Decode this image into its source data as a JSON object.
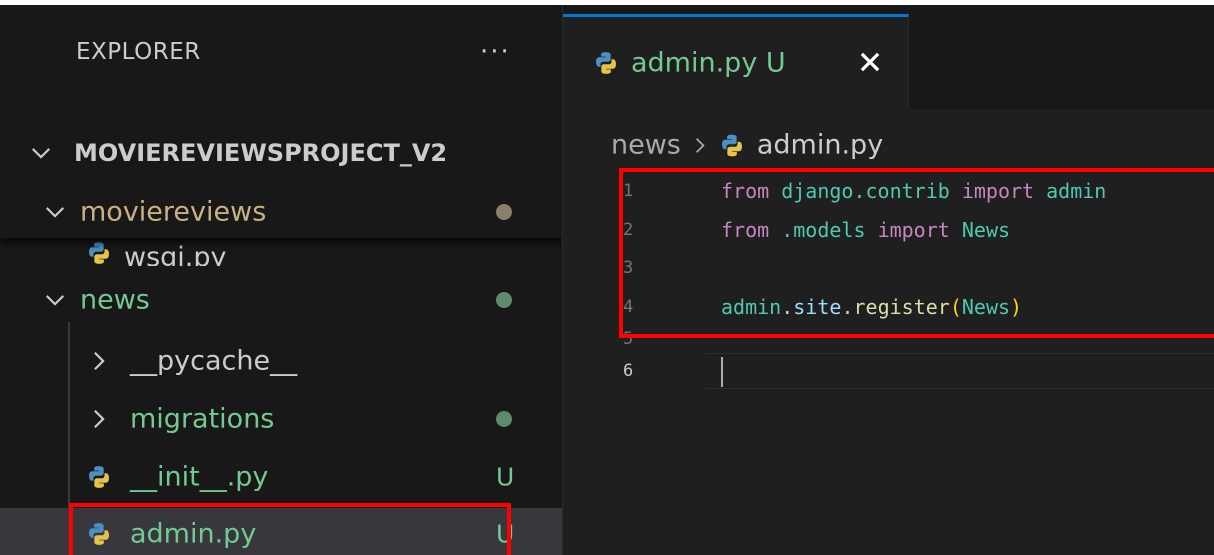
{
  "colors": {
    "sidebar_bg": "#181818",
    "editor_bg": "#1f1f1f",
    "git_untracked": "#73c991",
    "git_modified_dot": "#8b7e6a",
    "highlight": "#ff0000",
    "active_tab_border": "#0078d4"
  },
  "sidebar": {
    "title": "EXPLORER",
    "more_label": "···",
    "project": "MOVIEREVIEWSPROJECT_V2",
    "tree": [
      {
        "label": "moviereviews",
        "type": "folder",
        "expanded": true,
        "decoration": "dot"
      },
      {
        "label": "wsgi.py",
        "type": "file"
      },
      {
        "label": "news",
        "type": "folder",
        "expanded": true,
        "decoration": "dot"
      },
      {
        "label": "__pycache__",
        "type": "folder",
        "expanded": false
      },
      {
        "label": "migrations",
        "type": "folder",
        "expanded": false,
        "decoration": "dot"
      },
      {
        "label": "__init__.py",
        "type": "file",
        "badge": "U"
      },
      {
        "label": "admin.py",
        "type": "file",
        "badge": "U",
        "selected": true
      }
    ]
  },
  "editor": {
    "tab": {
      "label": "admin.py U",
      "icon": "python-icon"
    },
    "breadcrumb": {
      "folder": "news",
      "file": "admin.py"
    },
    "line_numbers": [
      "1",
      "2",
      "3",
      "4",
      "5",
      "6"
    ],
    "code": {
      "l1": {
        "kw1": "from",
        "mod": "django.contrib",
        "kw2": "import",
        "name": "admin"
      },
      "l2": {
        "kw1": "from",
        "mod": ".models",
        "kw2": "import",
        "name": "News"
      },
      "l4": {
        "obj": "admin",
        "dot1": ".",
        "attr": "site",
        "dot2": ".",
        "fn": "register",
        "open": "(",
        "arg": "News",
        "close": ")"
      }
    }
  }
}
